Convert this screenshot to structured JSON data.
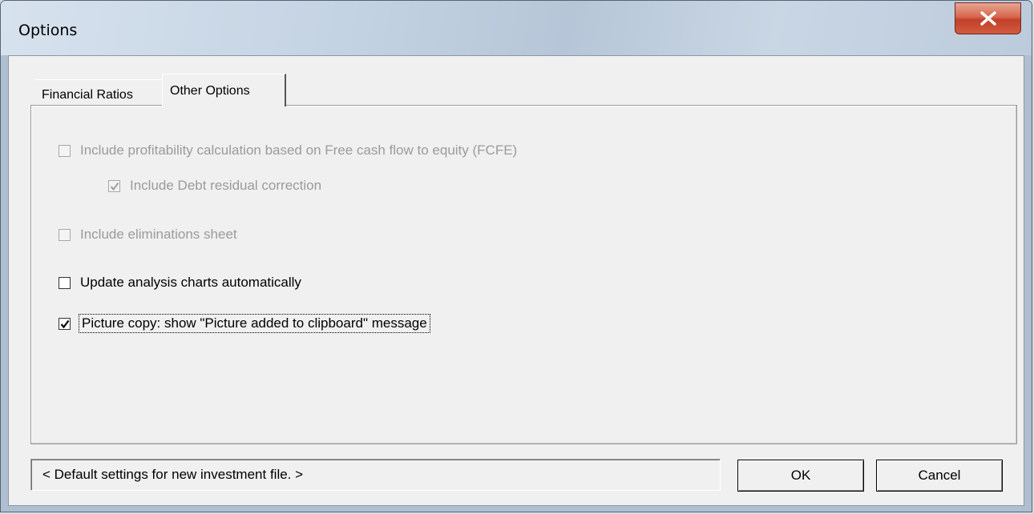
{
  "window": {
    "title": "Options"
  },
  "tabs": [
    {
      "label": "Financial Ratios",
      "active": false
    },
    {
      "label": "Other Options",
      "active": true
    }
  ],
  "options": {
    "fcfe": {
      "label": "Include profitability calculation based on Free cash flow to equity (FCFE)",
      "checked": false,
      "enabled": false
    },
    "debt_residual": {
      "label": "Include Debt residual correction",
      "checked": true,
      "enabled": false
    },
    "eliminations": {
      "label": "Include eliminations sheet",
      "checked": false,
      "enabled": false
    },
    "update_charts": {
      "label": "Update analysis charts automatically",
      "checked": false,
      "enabled": true
    },
    "picture_copy": {
      "label": "Picture copy: show \"Picture added to clipboard\" message",
      "checked": true,
      "enabled": true
    }
  },
  "status": {
    "text": "< Default settings for new investment file. >"
  },
  "buttons": {
    "ok": "OK",
    "cancel": "Cancel"
  },
  "icons": {
    "close": "close-icon",
    "checkmark": "checkmark-icon"
  },
  "colors": {
    "close_button": "#c9482f",
    "disabled_text": "#9b9b9b"
  }
}
